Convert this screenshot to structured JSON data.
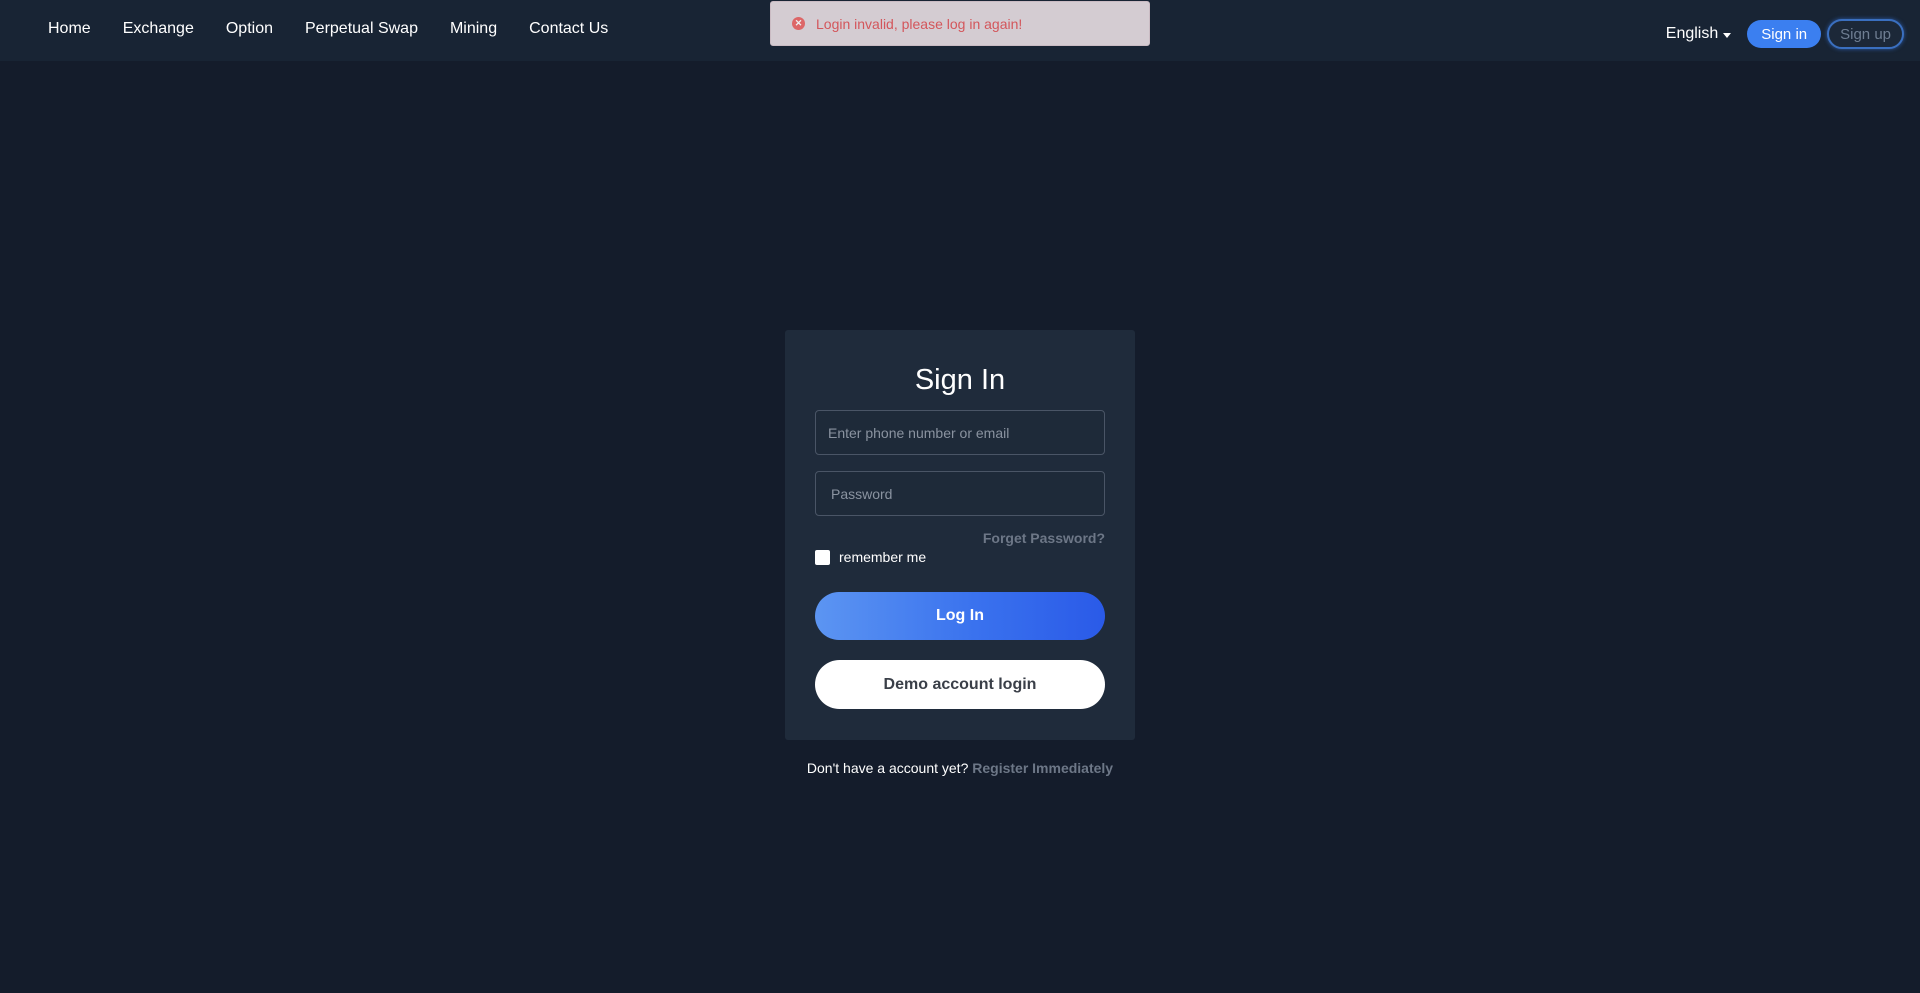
{
  "nav": {
    "items": [
      {
        "label": "Home"
      },
      {
        "label": "Exchange"
      },
      {
        "label": "Option"
      },
      {
        "label": "Perpetual Swap"
      },
      {
        "label": "Mining"
      },
      {
        "label": "Contact Us"
      }
    ]
  },
  "header": {
    "language": "English",
    "signin_label": "Sign in",
    "signup_label": "Sign up"
  },
  "toast": {
    "icon": "error-circle-icon",
    "message": "Login invalid, please log in again!",
    "color": "#e25a5f"
  },
  "login": {
    "title": "Sign In",
    "username_placeholder": "Enter phone number or email",
    "username_value": "",
    "password_placeholder": "Password",
    "password_value": "",
    "forget_label": "Forget Password?",
    "remember_label": "remember me",
    "remember_checked": false,
    "login_button": "Log In",
    "demo_button": "Demo account login"
  },
  "register": {
    "prompt": "Don't have a account yet?",
    "link": "Register Immediately"
  },
  "colors": {
    "background": "#141c2b",
    "topbar": "#182434",
    "card": "#1f2b3b",
    "accent": "#3b7ff0"
  }
}
